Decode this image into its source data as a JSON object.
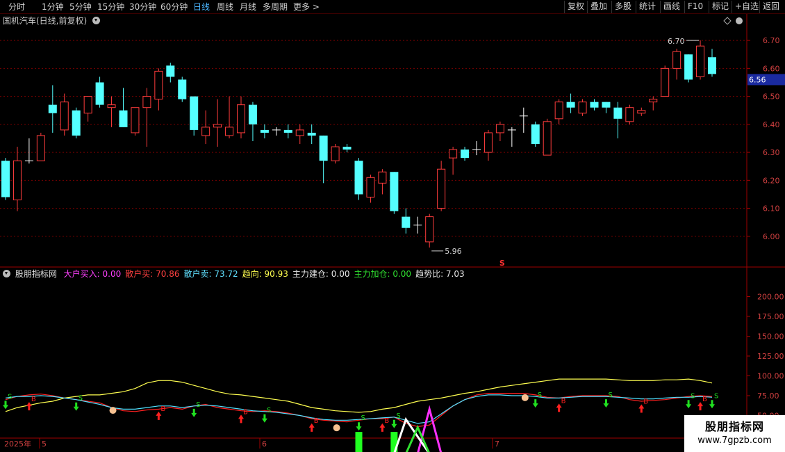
{
  "toolbar": {
    "periods": [
      "分时",
      "1分钟",
      "5分钟",
      "15分钟",
      "30分钟",
      "60分钟",
      "日线",
      "周线",
      "月线",
      "多周期",
      "更多 >"
    ],
    "active_period": "日线",
    "buttons": [
      "复权",
      "叠加",
      "多股",
      "统计",
      "画线",
      "F10",
      "标记",
      "+自选",
      "返回"
    ]
  },
  "main_panel": {
    "title": "国机汽车(日线,前复权)",
    "price_tag": "6.56",
    "max_label": "6.70",
    "min_label": "5.96",
    "marker": "S"
  },
  "indicator_panel": {
    "name": "股朋指标网",
    "items": [
      {
        "label": "大户买入:",
        "value": "0.00",
        "color": "#ff40ff"
      },
      {
        "label": "散户买:",
        "value": "70.86",
        "color": "#ff4040"
      },
      {
        "label": "散户卖:",
        "value": "73.72",
        "color": "#60e0ff"
      },
      {
        "label": "趋向:",
        "value": "90.93",
        "color": "#ffff50"
      },
      {
        "label": "主力建仓:",
        "value": "0.00",
        "color": "#e8e8e8"
      },
      {
        "label": "主力加仓:",
        "value": "0.00",
        "color": "#30e030"
      },
      {
        "label": "趋势比:",
        "value": "7.03",
        "color": "#e8e8e8"
      }
    ]
  },
  "x_axis": {
    "year_label": "2025年",
    "month_labels": [
      "5",
      "6",
      "7"
    ]
  },
  "watermark": {
    "title": "股朋指标网",
    "url": "www.7gpzb.com"
  },
  "colors": {
    "up": "#ff3c3c",
    "down": "#54ffff",
    "grid": "#7a0000",
    "border": "#a00000",
    "ma_yellow": "#ffff50",
    "ma_red": "#ff2020",
    "ma_cyan": "#50e0ff"
  },
  "chart_data": [
    {
      "type": "candlestick",
      "title": "国机汽车(日线,前复权)",
      "ylim": [
        5.92,
        6.75
      ],
      "yticks": [
        6.0,
        6.1,
        6.2,
        6.3,
        6.4,
        6.5,
        6.6,
        6.7
      ],
      "ytick_labels": [
        "6.00",
        "6.10",
        "6.20",
        "6.30",
        "6.40",
        "6.50",
        "6.60",
        "6.70"
      ],
      "current_price": 6.56,
      "annotations": [
        {
          "text": "6.70",
          "value": 6.7
        },
        {
          "text": "5.96",
          "value": 5.96
        }
      ],
      "candles": [
        {
          "o": 6.27,
          "c": 6.14,
          "h": 6.28,
          "l": 6.13
        },
        {
          "o": 6.13,
          "c": 6.27,
          "h": 6.32,
          "l": 6.09
        },
        {
          "o": 6.27,
          "c": 6.27,
          "h": 6.35,
          "l": 6.26
        },
        {
          "o": 6.27,
          "c": 6.36,
          "h": 6.37,
          "l": 6.27
        },
        {
          "o": 6.47,
          "c": 6.44,
          "h": 6.54,
          "l": 6.37
        },
        {
          "o": 6.38,
          "c": 6.48,
          "h": 6.51,
          "l": 6.36
        },
        {
          "o": 6.45,
          "c": 6.36,
          "h": 6.46,
          "l": 6.35
        },
        {
          "o": 6.44,
          "c": 6.5,
          "h": 6.5,
          "l": 6.41
        },
        {
          "o": 6.55,
          "c": 6.47,
          "h": 6.57,
          "l": 6.46
        },
        {
          "o": 6.46,
          "c": 6.47,
          "h": 6.5,
          "l": 6.39
        },
        {
          "o": 6.45,
          "c": 6.39,
          "h": 6.53,
          "l": 6.39
        },
        {
          "o": 6.37,
          "c": 6.46,
          "h": 6.46,
          "l": 6.36
        },
        {
          "o": 6.46,
          "c": 6.5,
          "h": 6.53,
          "l": 6.32
        },
        {
          "o": 6.49,
          "c": 6.59,
          "h": 6.6,
          "l": 6.45
        },
        {
          "o": 6.61,
          "c": 6.57,
          "h": 6.62,
          "l": 6.55
        },
        {
          "o": 6.56,
          "c": 6.49,
          "h": 6.57,
          "l": 6.48
        },
        {
          "o": 6.5,
          "c": 6.38,
          "h": 6.5,
          "l": 6.36
        },
        {
          "o": 6.36,
          "c": 6.39,
          "h": 6.45,
          "l": 6.33
        },
        {
          "o": 6.39,
          "c": 6.4,
          "h": 6.49,
          "l": 6.32
        },
        {
          "o": 6.36,
          "c": 6.39,
          "h": 6.5,
          "l": 6.35
        },
        {
          "o": 6.37,
          "c": 6.47,
          "h": 6.5,
          "l": 6.35
        },
        {
          "o": 6.47,
          "c": 6.4,
          "h": 6.48,
          "l": 6.34
        },
        {
          "o": 6.38,
          "c": 6.37,
          "h": 6.4,
          "l": 6.35
        },
        {
          "o": 6.38,
          "c": 6.38,
          "h": 6.39,
          "l": 6.36
        },
        {
          "o": 6.38,
          "c": 6.37,
          "h": 6.4,
          "l": 6.35
        },
        {
          "o": 6.36,
          "c": 6.38,
          "h": 6.4,
          "l": 6.33
        },
        {
          "o": 6.37,
          "c": 6.36,
          "h": 6.4,
          "l": 6.33
        },
        {
          "o": 6.36,
          "c": 6.27,
          "h": 6.36,
          "l": 6.19
        },
        {
          "o": 6.27,
          "c": 6.32,
          "h": 6.33,
          "l": 6.26
        },
        {
          "o": 6.32,
          "c": 6.31,
          "h": 6.33,
          "l": 6.3
        },
        {
          "o": 6.27,
          "c": 6.15,
          "h": 6.28,
          "l": 6.13
        },
        {
          "o": 6.14,
          "c": 6.21,
          "h": 6.22,
          "l": 6.12
        },
        {
          "o": 6.19,
          "c": 6.23,
          "h": 6.24,
          "l": 6.15
        },
        {
          "o": 6.23,
          "c": 6.09,
          "h": 6.23,
          "l": 6.08
        },
        {
          "o": 6.07,
          "c": 6.03,
          "h": 6.1,
          "l": 6.01
        },
        {
          "o": 6.04,
          "c": 6.04,
          "h": 6.07,
          "l": 6.01
        },
        {
          "o": 5.98,
          "c": 6.07,
          "h": 6.08,
          "l": 5.96
        },
        {
          "o": 6.1,
          "c": 6.24,
          "h": 6.27,
          "l": 6.09
        },
        {
          "o": 6.28,
          "c": 6.31,
          "h": 6.32,
          "l": 6.22
        },
        {
          "o": 6.31,
          "c": 6.28,
          "h": 6.32,
          "l": 6.27
        },
        {
          "o": 6.31,
          "c": 6.31,
          "h": 6.34,
          "l": 6.29
        },
        {
          "o": 6.3,
          "c": 6.37,
          "h": 6.38,
          "l": 6.27
        },
        {
          "o": 6.37,
          "c": 6.4,
          "h": 6.41,
          "l": 6.34
        },
        {
          "o": 6.38,
          "c": 6.38,
          "h": 6.39,
          "l": 6.32
        },
        {
          "o": 6.43,
          "c": 6.43,
          "h": 6.46,
          "l": 6.37
        },
        {
          "o": 6.4,
          "c": 6.33,
          "h": 6.41,
          "l": 6.32
        },
        {
          "o": 6.29,
          "c": 6.41,
          "h": 6.42,
          "l": 6.29
        },
        {
          "o": 6.42,
          "c": 6.48,
          "h": 6.49,
          "l": 6.4
        },
        {
          "o": 6.48,
          "c": 6.46,
          "h": 6.51,
          "l": 6.44
        },
        {
          "o": 6.44,
          "c": 6.48,
          "h": 6.49,
          "l": 6.43
        },
        {
          "o": 6.48,
          "c": 6.46,
          "h": 6.49,
          "l": 6.45
        },
        {
          "o": 6.48,
          "c": 6.46,
          "h": 6.48,
          "l": 6.44
        },
        {
          "o": 6.46,
          "c": 6.42,
          "h": 6.48,
          "l": 6.35
        },
        {
          "o": 6.41,
          "c": 6.46,
          "h": 6.47,
          "l": 6.4
        },
        {
          "o": 6.44,
          "c": 6.45,
          "h": 6.46,
          "l": 6.43
        },
        {
          "o": 6.48,
          "c": 6.49,
          "h": 6.5,
          "l": 6.45
        },
        {
          "o": 6.5,
          "c": 6.6,
          "h": 6.61,
          "l": 6.5
        },
        {
          "o": 6.6,
          "c": 6.66,
          "h": 6.67,
          "l": 6.56
        },
        {
          "o": 6.65,
          "c": 6.56,
          "h": 6.65,
          "l": 6.55
        },
        {
          "o": 6.57,
          "c": 6.68,
          "h": 6.7,
          "l": 6.56
        },
        {
          "o": 6.64,
          "c": 6.58,
          "h": 6.67,
          "l": 6.57
        }
      ]
    },
    {
      "type": "line",
      "title": "股朋指标网",
      "ylim": [
        25,
        225
      ],
      "yticks": [
        50,
        75,
        100,
        125,
        150,
        175,
        200
      ],
      "ytick_labels": [
        "50.00",
        "75.00",
        "100.00",
        "125.00",
        "150.00",
        "175.00",
        "200.00"
      ],
      "series": [
        {
          "name": "趋向",
          "values": [
            55,
            60,
            63,
            66,
            68,
            72,
            74,
            76,
            76,
            78,
            80,
            84,
            91,
            94,
            94,
            92,
            88,
            84,
            80,
            77,
            76,
            74,
            72,
            70,
            68,
            64,
            60,
            58,
            56,
            55,
            54,
            55,
            58,
            60,
            64,
            68,
            70,
            72,
            75,
            78,
            80,
            83,
            86,
            88,
            90,
            92,
            94,
            96,
            96,
            96,
            96,
            96,
            95,
            94,
            94,
            94,
            95,
            95,
            96,
            94,
            91
          ]
        },
        {
          "name": "散户买",
          "values": [
            70,
            74,
            76,
            77,
            75,
            72,
            70,
            68,
            66,
            60,
            56,
            55,
            57,
            58,
            60,
            58,
            62,
            64,
            60,
            58,
            56,
            55,
            56,
            55,
            53,
            50,
            46,
            44,
            43,
            42,
            44,
            46,
            46,
            48,
            40,
            36,
            38,
            50,
            62,
            70,
            76,
            78,
            78,
            78,
            78,
            76,
            73,
            72,
            74,
            75,
            75,
            75,
            74,
            70,
            68,
            69,
            70,
            72,
            74,
            75,
            74
          ]
        },
        {
          "name": "散户卖",
          "values": [
            72,
            74,
            74,
            75,
            74,
            72,
            70,
            67,
            64,
            60,
            58,
            58,
            60,
            62,
            62,
            60,
            62,
            63,
            62,
            60,
            58,
            56,
            55,
            54,
            52,
            50,
            47,
            45,
            44,
            44,
            45,
            46,
            47,
            48,
            44,
            40,
            42,
            52,
            62,
            70,
            74,
            76,
            76,
            75,
            75,
            74,
            72,
            72,
            73,
            74,
            74,
            74,
            73,
            72,
            71,
            71,
            72,
            73,
            73,
            74,
            73
          ]
        },
        {
          "name": "主力建仓",
          "values": [
            0,
            0,
            0,
            0,
            0,
            0,
            0,
            0,
            0,
            0,
            0,
            0,
            0,
            0,
            0,
            0,
            0,
            0,
            0,
            0,
            0,
            0,
            0,
            0,
            0,
            0,
            0,
            0,
            0,
            0,
            0,
            0,
            0,
            0,
            0,
            0,
            0,
            0,
            0,
            0,
            0,
            0,
            0,
            0,
            0,
            0,
            0,
            0,
            0,
            0,
            0,
            0,
            0,
            0,
            0,
            0,
            0,
            0,
            0,
            0,
            0
          ]
        },
        {
          "name": "主力加仓",
          "values": [
            0,
            0,
            0,
            0,
            0,
            0,
            0,
            0,
            0,
            0,
            0,
            0,
            0,
            0,
            0,
            0,
            0,
            0,
            0,
            0,
            0,
            0,
            0,
            0,
            0,
            0,
            0,
            0,
            0,
            0,
            0,
            0,
            0,
            0,
            0,
            0,
            0,
            0,
            0,
            0,
            0,
            0,
            0,
            0,
            0,
            0,
            0,
            0,
            0,
            0,
            0,
            0,
            0,
            0,
            0,
            0,
            0,
            0,
            0,
            0,
            0
          ]
        }
      ],
      "bars": [
        {
          "index": 30,
          "value": 10
        },
        {
          "index": 33,
          "value": 10
        }
      ],
      "spikes": [
        {
          "name": "大户买入",
          "from": 35,
          "peak": 36,
          "to": 37,
          "value": 58
        },
        {
          "name": "白线",
          "from": 33,
          "peak": 34,
          "to": 36,
          "value": 45
        },
        {
          "name": "绿线",
          "from": 34,
          "peak": 35,
          "to": 36,
          "value": 35
        }
      ],
      "buy_signals": [
        2,
        13,
        20,
        26,
        32,
        47,
        54,
        59
      ],
      "sell_signals": [
        0,
        6,
        16,
        22,
        30,
        33,
        45,
        51,
        58,
        60
      ]
    }
  ]
}
